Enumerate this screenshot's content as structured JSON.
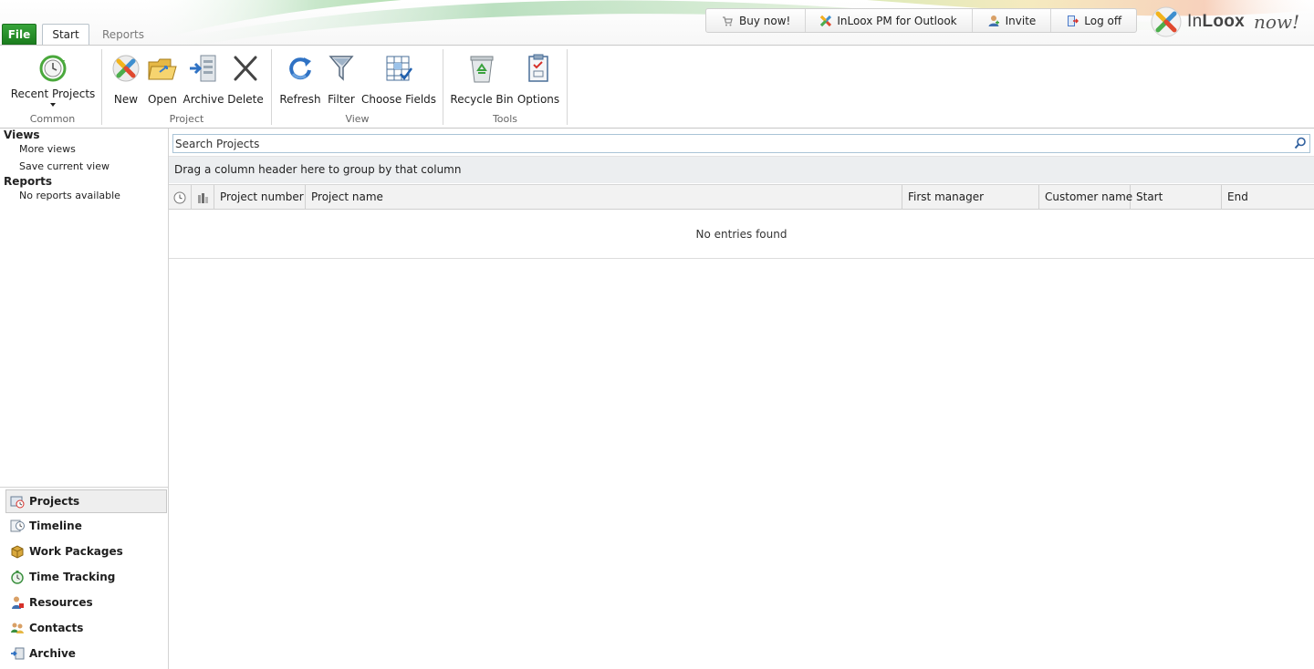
{
  "header": {
    "tabs": {
      "file": "File",
      "start": "Start",
      "reports": "Reports"
    },
    "links": {
      "buy": "Buy now!",
      "outlook": "InLoox PM for Outlook",
      "invite": "Invite",
      "logoff": "Log off"
    },
    "logo": {
      "brand_pre": "In",
      "brand_bold": "Loox",
      "suffix": "now!"
    }
  },
  "ribbon": {
    "common": {
      "label": "Common",
      "recent": "Recent Projects"
    },
    "project": {
      "label": "Project",
      "new": "New",
      "open": "Open",
      "archive": "Archive",
      "delete": "Delete"
    },
    "view": {
      "label": "View",
      "refresh": "Refresh",
      "filter": "Filter",
      "choose_fields": "Choose Fields"
    },
    "tools": {
      "label": "Tools",
      "recycle_bin": "Recycle Bin",
      "options": "Options"
    }
  },
  "left_panel": {
    "views_heading": "Views",
    "more_views": "More views",
    "save_view": "Save current view",
    "reports_heading": "Reports",
    "no_reports": "No reports available",
    "nav": {
      "projects": "Projects",
      "timeline": "Timeline",
      "work_packages": "Work Packages",
      "time_tracking": "Time Tracking",
      "resources": "Resources",
      "contacts": "Contacts",
      "archive": "Archive"
    },
    "active_nav": "Projects"
  },
  "main": {
    "search_placeholder": "Search Projects",
    "group_hint": "Drag a column header here to group by that column",
    "columns": {
      "project_number": "Project number",
      "project_name": "Project name",
      "first_manager": "First manager",
      "customer_name": "Customer name",
      "start": "Start",
      "end": "End"
    },
    "empty_message": "No entries found"
  },
  "colors": {
    "file_tab": "#1f8a22",
    "accent_swoosh": "#7fc55a",
    "border": "#c9c9c9"
  },
  "icons": [
    "search-icon",
    "clock-icon",
    "status-icon",
    "recent-projects-icon",
    "new-icon",
    "open-folder-icon",
    "archive-icon",
    "delete-icon",
    "refresh-icon",
    "filter-icon",
    "choose-fields-icon",
    "recycle-bin-icon",
    "options-icon"
  ]
}
